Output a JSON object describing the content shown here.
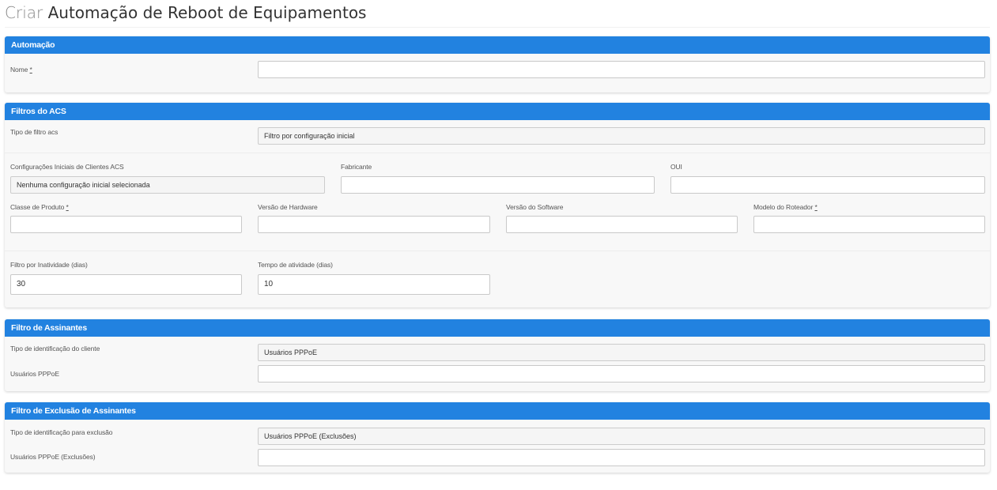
{
  "page": {
    "title_prefix": "Criar",
    "title_main": "Automação de Reboot de Equipamentos"
  },
  "automacao": {
    "header": "Automação",
    "nome_label": "Nome",
    "required_mark": "*",
    "nome_value": ""
  },
  "filtros_acs": {
    "header": "Filtros do ACS",
    "tipo_filtro_label": "Tipo de filtro acs",
    "tipo_filtro_value": "Filtro por configuração inicial",
    "config_iniciais_label": "Configurações Iniciais de Clientes ACS",
    "config_iniciais_value": "Nenhuma configuração inicial selecionada",
    "fabricante_label": "Fabricante",
    "fabricante_value": "",
    "oui_label": "OUI",
    "oui_value": "",
    "classe_produto_label": "Classe de Produto",
    "classe_produto_value": "",
    "versao_hardware_label": "Versão de Hardware",
    "versao_hardware_value": "",
    "versao_software_label": "Versão do Software",
    "versao_software_value": "",
    "modelo_roteador_label": "Modelo do Roteador",
    "modelo_roteador_value": "",
    "inatividade_label": "Filtro por Inatividade (dias)",
    "inatividade_value": "30",
    "atividade_label": "Tempo de atividade (dias)",
    "atividade_value": "10"
  },
  "filtro_assinantes": {
    "header": "Filtro de Assinantes",
    "tipo_id_label": "Tipo de identificação do cliente",
    "tipo_id_value": "Usuários PPPoE",
    "usuarios_label": "Usuários PPPoE",
    "usuarios_value": ""
  },
  "filtro_exclusao": {
    "header": "Filtro de Exclusão de Assinantes",
    "tipo_id_label": "Tipo de identificação para exclusão",
    "tipo_id_value": "Usuários PPPoE (Exclusões)",
    "usuarios_label": "Usuários PPPoE (Exclusões)",
    "usuarios_value": ""
  },
  "colors": {
    "panel_header": "#2282e0",
    "panel_body": "#f8f8f8"
  }
}
